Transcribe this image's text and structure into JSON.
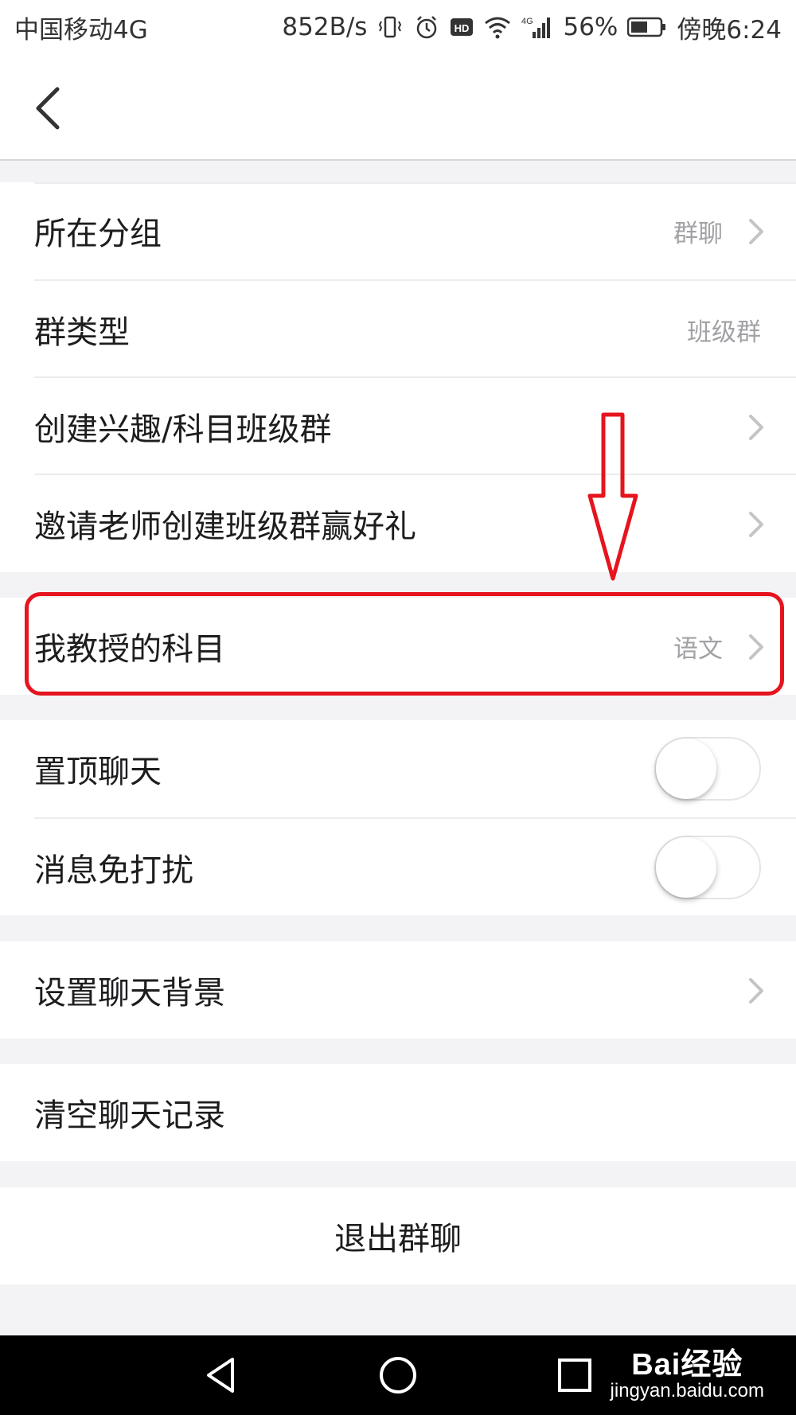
{
  "status_bar": {
    "carrier": "中国移动4G",
    "speed": "852B/s",
    "battery": "56%",
    "time": "傍晚6:24"
  },
  "settings": {
    "group_row": {
      "label": "所在分组",
      "value": "群聊"
    },
    "group_type_row": {
      "label": "群类型",
      "value": "班级群"
    },
    "create_subject_group_row": {
      "label": "创建兴趣/科目班级群"
    },
    "invite_teacher_row": {
      "label": "邀请老师创建班级群赢好礼"
    },
    "subject_row": {
      "label": "我教授的科目",
      "value": "语文"
    },
    "pin_chat_row": {
      "label": "置顶聊天",
      "toggle_on": false
    },
    "mute_row": {
      "label": "消息免打扰",
      "toggle_on": false
    },
    "chat_background_row": {
      "label": "设置聊天背景"
    },
    "clear_history_row": {
      "label": "清空聊天记录"
    },
    "exit_group_row": {
      "label": "退出群聊"
    }
  },
  "watermark": {
    "brand": "Bai经验",
    "url": "jingyan.baidu.com"
  },
  "colors": {
    "annotation_red": "#e5141e",
    "background": "#f3f3f5",
    "value_gray": "#a2a2a6"
  }
}
